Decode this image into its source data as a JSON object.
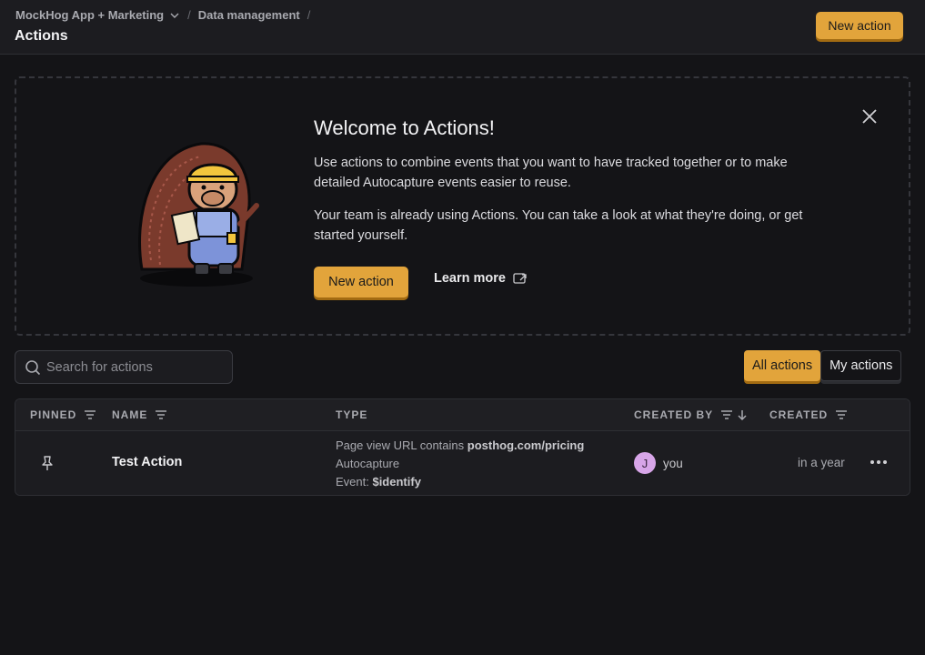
{
  "breadcrumb": {
    "project": "MockHog App + Marketing",
    "section": "Data management",
    "separator": "/"
  },
  "page_title": "Actions",
  "header": {
    "new_action_label": "New action"
  },
  "welcome": {
    "title": "Welcome to Actions!",
    "paragraph1": "Use actions to combine events that you want to have tracked together or to make detailed Autocapture events easier to reuse.",
    "paragraph2": "Your team is already using Actions. You can take a look at what they're doing, or get started yourself.",
    "new_action_label": "New action",
    "learn_more_label": "Learn more"
  },
  "search": {
    "placeholder": "Search for actions",
    "value": ""
  },
  "filter": {
    "all_label": "All actions",
    "mine_label": "My actions",
    "selected": "All actions"
  },
  "table": {
    "columns": {
      "pinned": "PINNED",
      "name": "NAME",
      "type": "TYPE",
      "created_by": "CREATED BY",
      "created": "CREATED"
    },
    "rows": [
      {
        "name": "Test Action",
        "type_line1_prefix": "Page view URL contains ",
        "type_line1_value": "posthog.com/pricing",
        "type_line2": "Autocapture",
        "type_line3_prefix": "Event: ",
        "type_line3_value": "$identify",
        "creator_initial": "J",
        "creator_name": "you",
        "created": "in a year"
      }
    ]
  },
  "colors": {
    "accent": "#e2a43b",
    "background": "#141417",
    "avatar": "#d7a5e8"
  }
}
